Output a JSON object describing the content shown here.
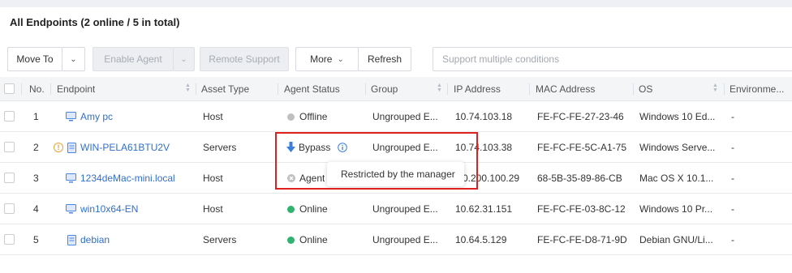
{
  "page": {
    "title": "All Endpoints",
    "subtitle": "(2 online / 5 in total)"
  },
  "toolbar": {
    "move_to": "Move To",
    "enable_agent": "Enable Agent",
    "remote_support": "Remote Support",
    "more": "More",
    "refresh": "Refresh",
    "search_placeholder": "Support multiple conditions"
  },
  "table": {
    "columns": [
      "No.",
      "Endpoint",
      "Asset Type",
      "Agent Status",
      "Group",
      "IP Address",
      "MAC Address",
      "OS",
      "Environme..."
    ],
    "rows": [
      {
        "no": "1",
        "endpoint": "Amy pc",
        "asset_type": "Host",
        "status": "Offline",
        "group": "Ungrouped E...",
        "ip": "10.74.103.18",
        "mac": "FE-FC-FE-27-23-46",
        "os": "Windows 10 Ed...",
        "env": "-"
      },
      {
        "no": "2",
        "endpoint": "WIN-PELA61BTU2V",
        "asset_type": "Servers",
        "status": "Bypass",
        "group": "Ungrouped E...",
        "ip": "10.74.103.38",
        "mac": "FE-FC-FE-5C-A1-75",
        "os": "Windows Serve...",
        "env": "-"
      },
      {
        "no": "3",
        "endpoint": "1234deMac-mini.local",
        "asset_type": "Host",
        "status": "Agent",
        "group": "",
        "ip": "0.200.100.29",
        "mac": "68-5B-35-89-86-CB",
        "os": "Mac OS X 10.1...",
        "env": "-"
      },
      {
        "no": "4",
        "endpoint": "win10x64-EN",
        "asset_type": "Host",
        "status": "Online",
        "group": "Ungrouped E...",
        "ip": "10.62.31.151",
        "mac": "FE-FC-FE-03-8C-12",
        "os": "Windows 10 Pr...",
        "env": "-"
      },
      {
        "no": "5",
        "endpoint": "debian",
        "asset_type": "Servers",
        "status": "Online",
        "group": "Ungrouped E...",
        "ip": "10.64.5.129",
        "mac": "FE-FC-FE-D8-71-9D",
        "os": "Debian GNU/Li...",
        "env": "-"
      }
    ]
  },
  "tooltip": {
    "text": "Restricted by the manager"
  },
  "colors": {
    "link": "#2f6fd1",
    "offline_dot": "#bfbfbf",
    "online_dot": "#2fb36f",
    "bypass_arrow": "#3b7ddd",
    "warning": "#e6a23c",
    "highlight": "#e01f1f"
  },
  "icons": {
    "host": "monitor-icon",
    "server": "server-icon",
    "warning": "warning-icon",
    "info": "info-icon",
    "bypass": "arrow-down-icon"
  }
}
